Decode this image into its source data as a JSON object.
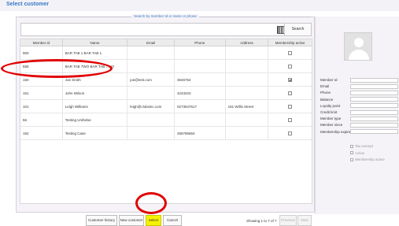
{
  "window": {
    "title": "Select customer"
  },
  "search": {
    "legend": "Search by member Id or name or phone",
    "value": "",
    "button": "Search",
    "barcode_icon": "barcode-icon"
  },
  "table": {
    "columns": [
      "Member id",
      "Name",
      "Email",
      "Phone",
      "Address",
      "Membership active"
    ],
    "rows": [
      {
        "id": "900",
        "name": "BAR TAB 1 BAR TAB 1",
        "email": "",
        "phone": "",
        "address": "",
        "active": false
      },
      {
        "id": "555",
        "name": "BAR TAB TWO BAR TAB TWO",
        "email": "",
        "phone": "",
        "address": "",
        "active": false
      },
      {
        "id": "150",
        "name": "Joe Smith",
        "email": "joe@test.com",
        "phone": "3646754",
        "address": "",
        "active": true
      },
      {
        "id": "151",
        "name": "John Wilson",
        "email": "",
        "phone": "4243223",
        "address": "",
        "active": false
      },
      {
        "id": "101",
        "name": "Leigh Williams",
        "email": "leigh@clubsinc.com",
        "phone": "0273647617",
        "address": "181 Willis Street",
        "active": false
      },
      {
        "id": "56",
        "name": "Testing Unihelse",
        "email": "",
        "phone": "",
        "address": "",
        "active": false
      },
      {
        "id": "152",
        "name": "Testing Case",
        "email": "",
        "phone": "456786654",
        "address": "",
        "active": false
      }
    ]
  },
  "buttons": {
    "history": "Customer history",
    "new": "New customer",
    "select": "Select",
    "cancel": "Cancel",
    "previous": "Previous",
    "next": "Next"
  },
  "paging": {
    "text": "Showing 1 to 7 of 7"
  },
  "details": {
    "fields": [
      "Member Id",
      "Email",
      "Phone",
      "Balance",
      "Loyalty point",
      "Credit limit",
      "Member type",
      "Member since",
      "Membership expire"
    ],
    "checks": [
      "Tax exempt",
      "Active",
      "Membership active"
    ]
  },
  "colors": {
    "accent": "#3a77c6",
    "highlight": "#e00000",
    "select_button": "#f6f200"
  }
}
